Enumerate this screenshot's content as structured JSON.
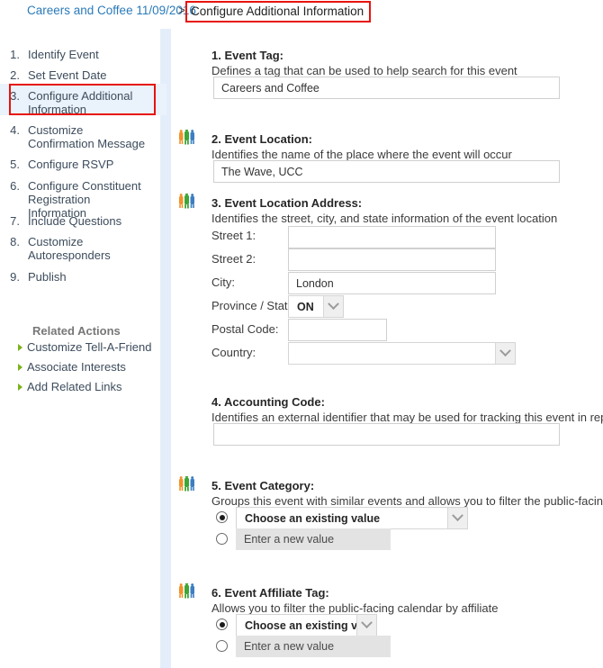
{
  "breadcrumb": {
    "parent": "Careers and Coffee 11/09/2016",
    "separator": ">",
    "current": "Configure Additional Information",
    "highlight_color": "#e8130d",
    "link_color": "#2a7ab9"
  },
  "sidebar": {
    "steps": [
      {
        "num": "1.",
        "label": "Identify Event"
      },
      {
        "num": "2.",
        "label": "Set Event Date"
      },
      {
        "num": "3.",
        "label": "Configure Additional Information"
      },
      {
        "num": "4.",
        "label": "Customize Confirmation Message"
      },
      {
        "num": "5.",
        "label": "Configure RSVP"
      },
      {
        "num": "6.",
        "label": "Configure Constituent Registration Information"
      },
      {
        "num": "7.",
        "label": "Include Questions"
      },
      {
        "num": "8.",
        "label": "Customize Autoresponders"
      },
      {
        "num": "9.",
        "label": "Publish"
      }
    ],
    "active_step": "3.",
    "related_actions_title": "Related Actions",
    "related_actions": [
      {
        "label": "Customize Tell-A-Friend"
      },
      {
        "label": "Associate Interests"
      },
      {
        "label": "Add Related Links"
      }
    ],
    "bullet_color": "#7ab317",
    "active_bg": "#eaf2fb"
  },
  "main": {
    "event_tag": {
      "number": "1.",
      "title": "Event Tag:",
      "description": "Defines a tag that can be used to help search for this event",
      "value": "Careers and Coffee",
      "has_people_icon": false
    },
    "event_location": {
      "number": "2.",
      "title": "Event Location:",
      "description": "Identifies the name of the place where the event will occur",
      "value": "The Wave, UCC",
      "has_people_icon": true
    },
    "event_location_address": {
      "number": "3.",
      "title": "Event Location Address:",
      "description": "Identifies the street, city, and state information of the event location",
      "has_people_icon": true,
      "fields": [
        {
          "label": "Street 1:",
          "value": "",
          "type": "text"
        },
        {
          "label": "Street 2:",
          "value": "",
          "type": "text"
        },
        {
          "label": "City:",
          "value": "London",
          "type": "text"
        },
        {
          "label": "Province / State:",
          "value": "ON",
          "type": "select"
        },
        {
          "label": "Postal Code:",
          "value": "",
          "type": "text"
        },
        {
          "label": "Country:",
          "value": "",
          "type": "select"
        }
      ]
    },
    "accounting_code": {
      "number": "4.",
      "title": "Accounting Code:",
      "description": "Identifies an external identifier that may be used for tracking this event in reports",
      "value": "",
      "has_people_icon": false
    },
    "event_category": {
      "number": "5.",
      "title": "Event Category:",
      "description": "Groups this event with similar events and allows you to filter the public-facing calendar",
      "has_people_icon": true,
      "option_existing_label": "Choose an existing value",
      "option_new_label": "Enter a new value",
      "selected": "existing"
    },
    "event_affiliate_tag": {
      "number": "6.",
      "title": "Event Affiliate Tag:",
      "description": "Allows you to filter the public-facing calendar by affiliate",
      "has_people_icon": true,
      "option_existing_label": "Choose an existing value",
      "option_new_label": "Enter a new value",
      "selected": "existing"
    }
  }
}
